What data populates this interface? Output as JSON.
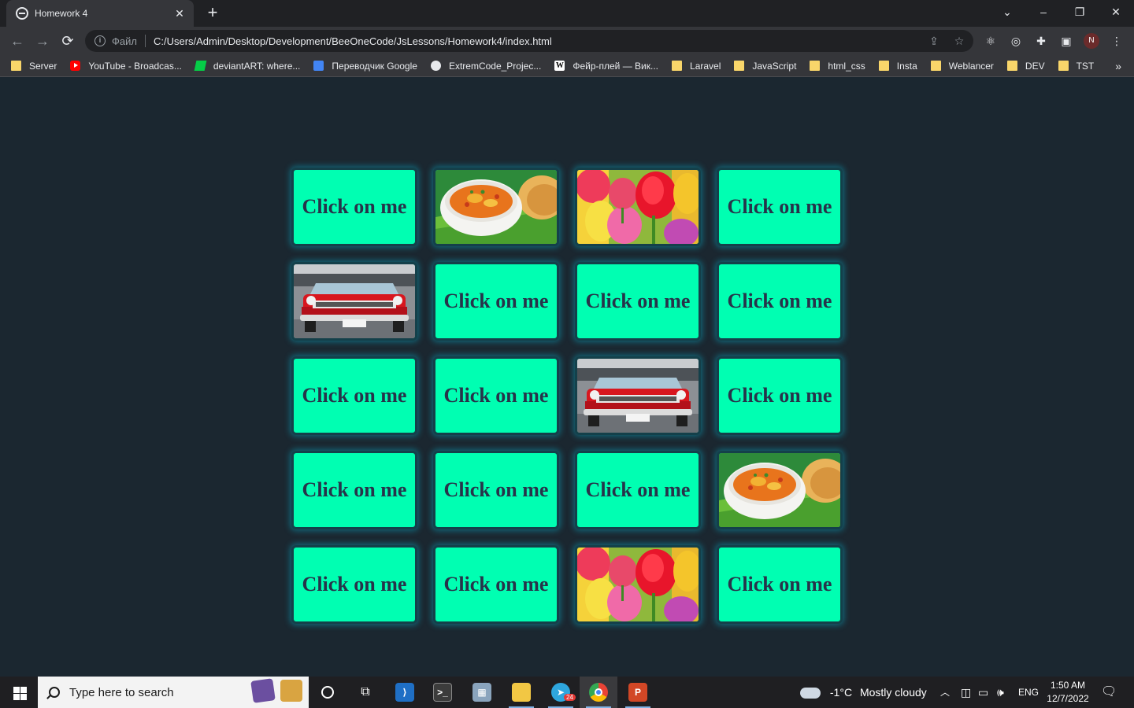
{
  "browser": {
    "tab_title": "Homework 4",
    "tab_close": "✕",
    "new_tab": "+",
    "window_controls": {
      "menu": "⌄",
      "minimize": "–",
      "restore": "❐",
      "close": "✕"
    },
    "scheme_label": "Файл",
    "url": "C:/Users/Admin/Desktop/Development/BeeOneCode/JsLessons/Homework4/index.html",
    "profile_initial": "N",
    "bookmarks": [
      {
        "label": "Server",
        "icon": "folder-icon"
      },
      {
        "label": "YouTube - Broadcas...",
        "icon": "youtube-icon"
      },
      {
        "label": "deviantART: where...",
        "icon": "deviantart-icon"
      },
      {
        "label": "Переводчик Google",
        "icon": "google-translate-icon"
      },
      {
        "label": "ExtremCode_Projec...",
        "icon": "github-icon"
      },
      {
        "label": "Фейр-плей — Вик...",
        "icon": "wikipedia-icon"
      },
      {
        "label": "Laravel",
        "icon": "folder-icon"
      },
      {
        "label": "JavaScript",
        "icon": "folder-icon"
      },
      {
        "label": "html_css",
        "icon": "folder-icon"
      },
      {
        "label": "Insta",
        "icon": "folder-icon"
      },
      {
        "label": "Weblancer",
        "icon": "folder-icon"
      },
      {
        "label": "DEV",
        "icon": "folder-icon"
      },
      {
        "label": "TST",
        "icon": "folder-icon"
      }
    ],
    "bookmarks_more": "»"
  },
  "game": {
    "hidden_label": "Click on me",
    "cards": [
      {
        "state": "hidden"
      },
      {
        "state": "revealed",
        "image": "soup"
      },
      {
        "state": "revealed",
        "image": "tulips"
      },
      {
        "state": "hidden"
      },
      {
        "state": "revealed",
        "image": "car"
      },
      {
        "state": "hidden"
      },
      {
        "state": "hidden"
      },
      {
        "state": "hidden"
      },
      {
        "state": "hidden"
      },
      {
        "state": "hidden"
      },
      {
        "state": "revealed",
        "image": "car"
      },
      {
        "state": "hidden"
      },
      {
        "state": "hidden"
      },
      {
        "state": "hidden"
      },
      {
        "state": "hidden"
      },
      {
        "state": "revealed",
        "image": "soup"
      },
      {
        "state": "hidden"
      },
      {
        "state": "hidden"
      },
      {
        "state": "revealed",
        "image": "tulips"
      },
      {
        "state": "hidden"
      }
    ]
  },
  "taskbar": {
    "search_placeholder": "Type here to search",
    "telegram_badge": "24",
    "weather_temp": "-1°C",
    "weather_desc": "Mostly cloudy",
    "language": "ENG",
    "time": "1:50 AM",
    "date": "12/7/2022"
  },
  "colors": {
    "page_background": "#1b2730",
    "card_background": "#00ffb2",
    "card_text": "#27334a"
  }
}
